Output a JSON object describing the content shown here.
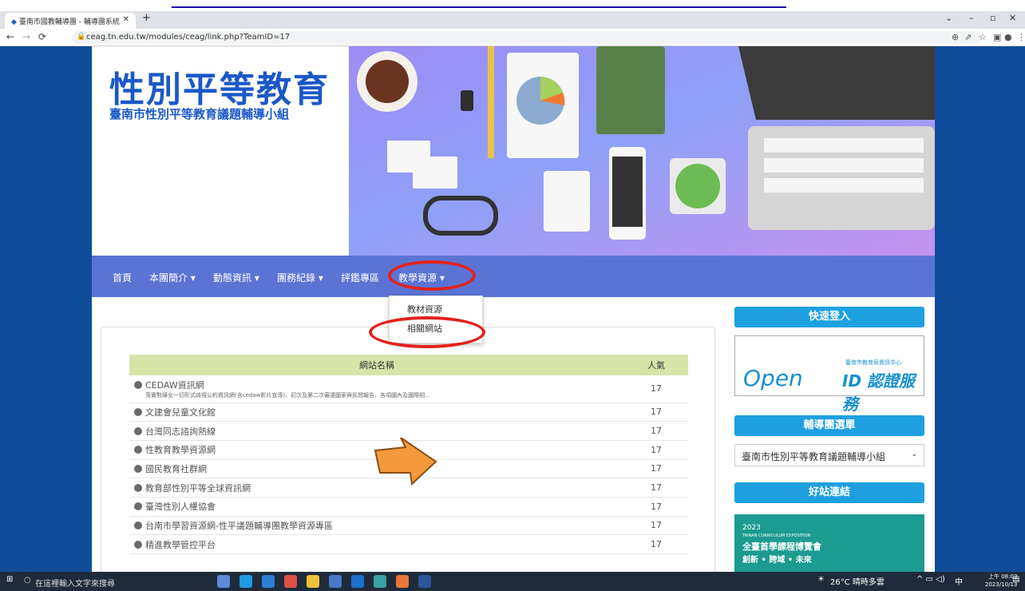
{
  "browser": {
    "tab_title": "臺南市國教輔導團 - 輔導團系統",
    "url": "ceag.tn.edu.tw/modules/ceag/link.php?TeamID=17"
  },
  "header": {
    "title": "性別平等教育",
    "subtitle": "臺南市性別平等教育議題輔導小組"
  },
  "menu": [
    {
      "label": "首頁"
    },
    {
      "label": "本團簡介 ▾"
    },
    {
      "label": "動態資訊 ▾"
    },
    {
      "label": "團務紀錄 ▾"
    },
    {
      "label": "評鑑專區"
    },
    {
      "label": "教學資源 ▾"
    }
  ],
  "dropdown": {
    "items": [
      "教材資源",
      "相關網站"
    ]
  },
  "table": {
    "col_name": "網站名稱",
    "col_pop": "人氣",
    "rows": [
      {
        "name": "CEDAW資訊網",
        "desc": "落實對婦女一切形式歧視公約資訊網(含cedaw影片宣導)、初次及第二次審議國家與民間報告、各項國內及國際相...",
        "pop": "17"
      },
      {
        "name": "文建會兒童文化館",
        "pop": "17"
      },
      {
        "name": "台灣同志諮詢熱線",
        "pop": "17"
      },
      {
        "name": "性教育教學資源網",
        "pop": "17"
      },
      {
        "name": "國民教育社群網",
        "pop": "17"
      },
      {
        "name": "教育部性別平等全球資訊網",
        "pop": "17"
      },
      {
        "name": "臺灣性別人權協會",
        "pop": "17"
      },
      {
        "name": "台南市學習資源網-性平議題輔導團教學資源專區",
        "pop": "17"
      },
      {
        "name": "精進教學管控平台",
        "pop": "17"
      }
    ]
  },
  "sidebar": {
    "login_title": "快速登入",
    "openid_a": "Open",
    "openid_b": "ID 認證服務",
    "openid_c": "臺南市教育局資訊中心",
    "team_menu_title": "輔導團選單",
    "team_select": "臺南市性別平等教育議題輔導小組",
    "links_title": "好站連結",
    "expo_year": "2023",
    "expo_en": "TAINAN CURRICULUM EXPOSITION",
    "expo_title": "全臺首學課程博覽會",
    "expo_sub": "創新 • 跨域 • 未來"
  },
  "taskbar": {
    "search": "在這裡輸入文字來搜尋",
    "weather": "26°C 晴時多雲",
    "ime": "中",
    "time": "上午 08:03",
    "date": "2023/10/13"
  }
}
